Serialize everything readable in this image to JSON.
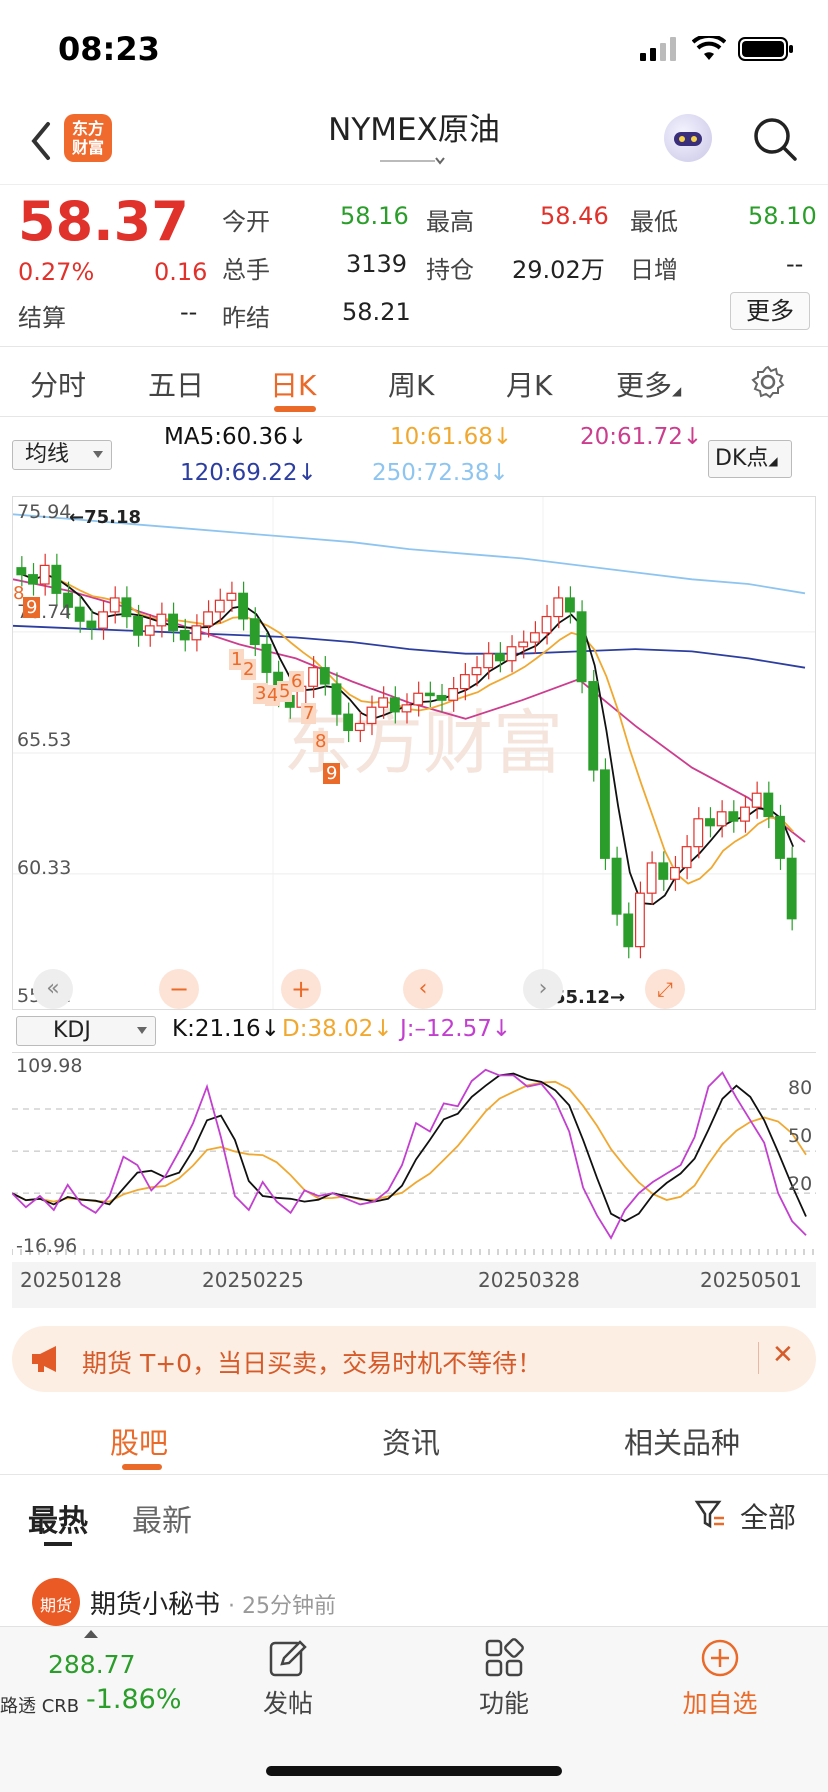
{
  "status": {
    "time": "08:23"
  },
  "header": {
    "logo_text": "东方财富",
    "title": "NYMEX原油"
  },
  "quote": {
    "price": "58.37",
    "change_pct": "0.27%",
    "change": "0.16",
    "open_label": "今开",
    "open": "58.16",
    "high_label": "最高",
    "high": "58.46",
    "low_label": "最低",
    "low": "58.10",
    "volume_label": "总手",
    "volume": "3139",
    "oi_label": "持仓",
    "oi": "29.02万",
    "daily_inc_label": "日增",
    "daily_inc": "--",
    "settle_label": "结算",
    "settle": "--",
    "prev_settle_label": "昨结",
    "prev_settle": "58.21",
    "more_label": "更多"
  },
  "period_tabs": [
    "分时",
    "五日",
    "日K",
    "周K",
    "月K",
    "更多"
  ],
  "ma_bar": {
    "select": "均线",
    "ma5": "MA5:60.36",
    "ma10": "10:61.68",
    "ma20": "20:61.72",
    "ma120": "120:69.22",
    "ma250": "250:72.38",
    "dk": "DK点"
  },
  "kdj_bar": {
    "select": "KDJ",
    "k": "K:21.16",
    "d": "D:38.02",
    "j": "J:–12.57"
  },
  "colors": {
    "up": "#e0322b",
    "down": "#2a9d2a",
    "accent": "#ea6a2a",
    "ma5": "#111111",
    "ma10": "#f0a830",
    "ma20": "#cc3d8e",
    "ma120": "#2c3ea0",
    "ma250": "#8ec5f0",
    "kdj_k": "#111111",
    "kdj_d": "#f0a830",
    "kdj_j": "#c23fcf"
  },
  "chart_data": [
    {
      "type": "candlestick",
      "y_ticks": [
        "75.94",
        "70.74",
        "65.53",
        "60.33",
        "55.12"
      ],
      "ylim": [
        55.12,
        75.94
      ],
      "max_label": "75.18",
      "min_label": "55.12",
      "annotations": [
        "8",
        "9",
        "1",
        "2",
        "3",
        "4",
        "5",
        "6",
        "7",
        "8",
        "9"
      ],
      "ma_lines": {
        "ma250": [
          75.8,
          75.6,
          75.4,
          75.2,
          75.0,
          74.8,
          74.6,
          74.3,
          74.1,
          73.9,
          73.6,
          73.3,
          73.0,
          72.8,
          72.4
        ],
        "ma120": [
          71.0,
          70.9,
          70.8,
          70.7,
          70.6,
          70.5,
          70.3,
          70.0,
          69.8,
          69.8,
          69.9,
          70.0,
          69.9,
          69.6,
          69.2
        ],
        "ma20": [
          73.0,
          72.5,
          71.8,
          71.0,
          70.2,
          69.6,
          68.6,
          67.7,
          67.0,
          67.8,
          68.7,
          66.7,
          64.9,
          63.6,
          61.7
        ]
      },
      "bottom_buttons": [
        "rewind",
        "zoom-out",
        "zoom-in",
        "prev",
        "next",
        "fullscreen"
      ]
    },
    {
      "type": "line",
      "title": "KDJ",
      "y_ticks_left": [
        "109.98",
        "-16.96"
      ],
      "y_ticks_right": [
        "80",
        "50",
        "20"
      ],
      "x_labels": [
        "20250128",
        "20250225",
        "20250328",
        "20250501"
      ]
    }
  ],
  "banner": {
    "text": "期货 T+0，当日买卖，交易时机不等待！"
  },
  "sub_tabs": [
    "股吧",
    "资讯",
    "相关品种"
  ],
  "feed_tabs": {
    "hot": "最热",
    "latest": "最新",
    "filter": "全部"
  },
  "post": {
    "avatar_text": "期货",
    "author": "期货小秘书",
    "time": "· 25分钟前"
  },
  "bottom": {
    "crb_value": "288.77",
    "crb_name": "路透 CRB",
    "crb_change": "-1.86%",
    "post": "发帖",
    "func": "功能",
    "add": "加自选"
  }
}
